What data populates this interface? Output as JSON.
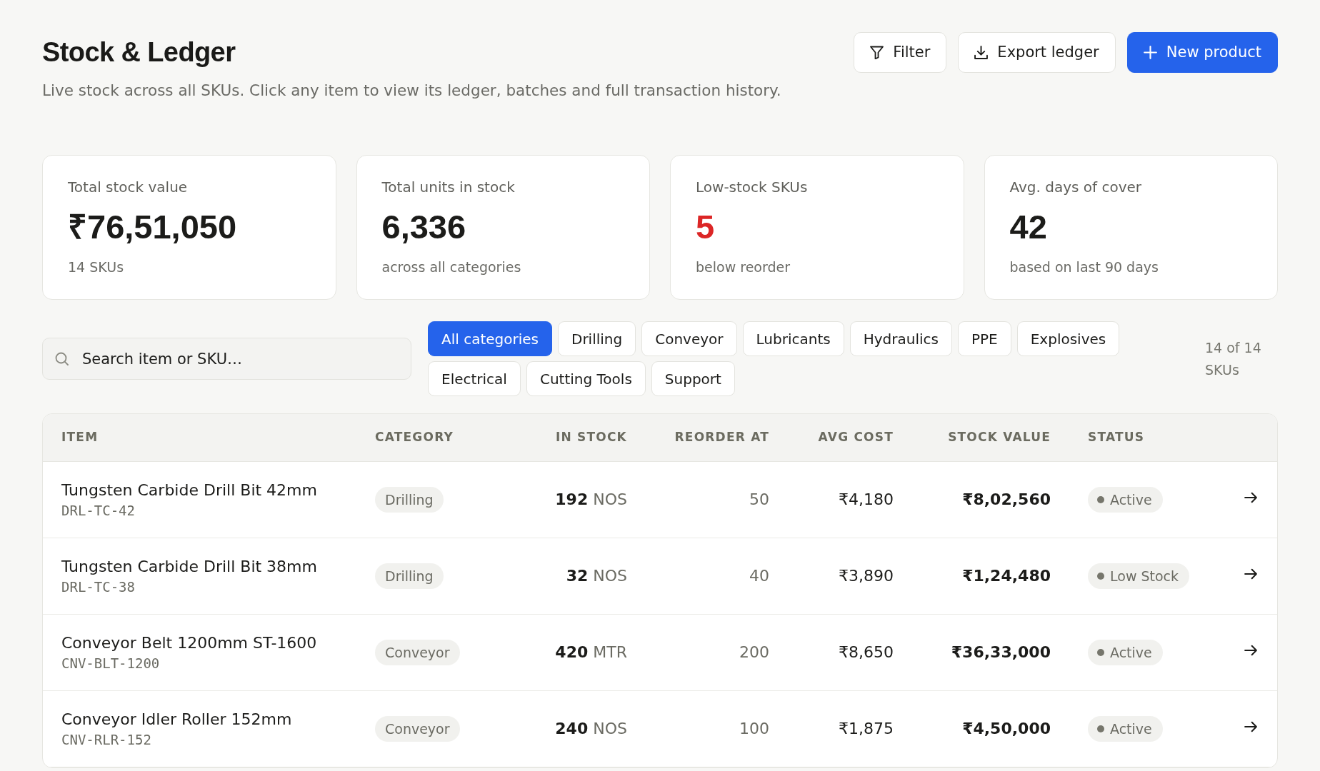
{
  "header": {
    "title": "Stock & Ledger",
    "subtitle": "Live stock across all SKUs. Click any item to view its ledger, batches and full transaction history.",
    "buttons": [
      {
        "label": "Filter",
        "kind": "filter",
        "primary": false
      },
      {
        "label": "Export ledger",
        "kind": "export",
        "primary": false
      },
      {
        "label": "New product",
        "kind": "create",
        "primary": true
      }
    ]
  },
  "stats": [
    {
      "label": "Total stock value",
      "value": "₹76,51,050",
      "note": "14 SKUs",
      "alert": false
    },
    {
      "label": "Total units in stock",
      "value": "6,336",
      "note": "across all categories",
      "alert": false
    },
    {
      "label": "Low-stock SKUs",
      "value": "5",
      "note": "below reorder",
      "alert": true
    },
    {
      "label": "Avg. days of cover",
      "value": "42",
      "note": "based on last 90 days",
      "alert": false
    }
  ],
  "search": {
    "placeholder": "Search item or SKU…"
  },
  "categories": [
    {
      "label": "All categories",
      "selected": true
    },
    {
      "label": "Drilling",
      "selected": false
    },
    {
      "label": "Conveyor",
      "selected": false
    },
    {
      "label": "Lubricants",
      "selected": false
    },
    {
      "label": "Hydraulics",
      "selected": false
    },
    {
      "label": "PPE",
      "selected": false
    },
    {
      "label": "Explosives",
      "selected": false
    },
    {
      "label": "Electrical",
      "selected": false
    },
    {
      "label": "Cutting Tools",
      "selected": false
    },
    {
      "label": "Support",
      "selected": false
    }
  ],
  "count": "14 of 14 SKUs",
  "table": {
    "columns": [
      "ITEM",
      "CATEGORY",
      "IN STOCK",
      "REORDER AT",
      "AVG COST",
      "STOCK VALUE",
      "STATUS"
    ],
    "rows": [
      {
        "name": "Tungsten Carbide Drill Bit 42mm",
        "sku": "DRL-TC-42",
        "category": "Drilling",
        "in_stock": "192",
        "unit": "NOS",
        "reorder_at": "50",
        "avg_cost": "₹4,180",
        "stock_value": "₹8,02,560",
        "status": "Active"
      },
      {
        "name": "Tungsten Carbide Drill Bit 38mm",
        "sku": "DRL-TC-38",
        "category": "Drilling",
        "in_stock": "32",
        "unit": "NOS",
        "reorder_at": "40",
        "avg_cost": "₹3,890",
        "stock_value": "₹1,24,480",
        "status": "Low Stock"
      },
      {
        "name": "Conveyor Belt 1200mm ST-1600",
        "sku": "CNV-BLT-1200",
        "category": "Conveyor",
        "in_stock": "420",
        "unit": "MTR",
        "reorder_at": "200",
        "avg_cost": "₹8,650",
        "stock_value": "₹36,33,000",
        "status": "Active"
      },
      {
        "name": "Conveyor Idler Roller 152mm",
        "sku": "CNV-RLR-152",
        "category": "Conveyor",
        "in_stock": "240",
        "unit": "NOS",
        "reorder_at": "100",
        "avg_cost": "₹1,875",
        "stock_value": "₹4,50,000",
        "status": "Active"
      }
    ]
  }
}
